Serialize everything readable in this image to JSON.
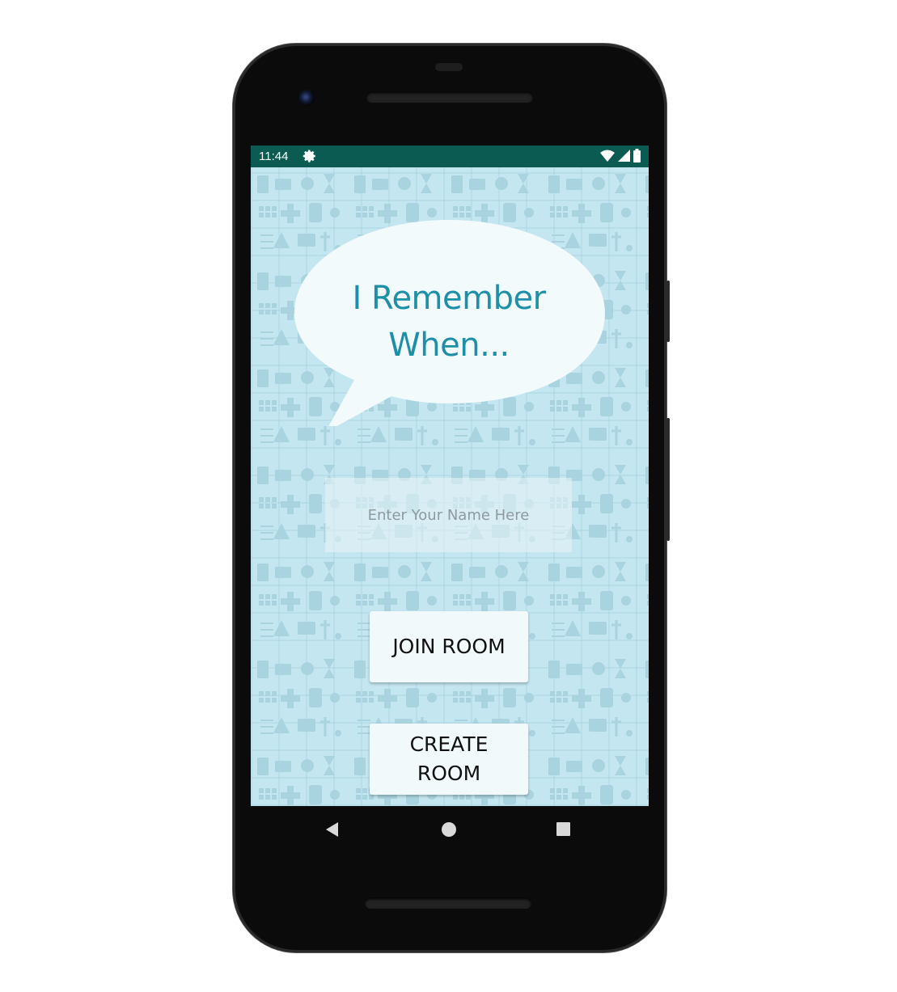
{
  "status_bar": {
    "time": "11:44",
    "icons": [
      "gear-icon",
      "wifi-icon",
      "signal-icon",
      "battery-icon"
    ],
    "background_color": "#0b5b52"
  },
  "app": {
    "title_line1": "I Remember",
    "title_line2": "When...",
    "title_color": "#1e8fa8",
    "background_color": "#c4e6f0",
    "name_input": {
      "placeholder": "Enter Your Name Here",
      "value": ""
    },
    "join_button_label": "JOIN ROOM",
    "create_button_label": "CREATE ROOM"
  },
  "nav_bar": {
    "icons": [
      "back-icon",
      "home-icon",
      "recents-icon"
    ]
  }
}
